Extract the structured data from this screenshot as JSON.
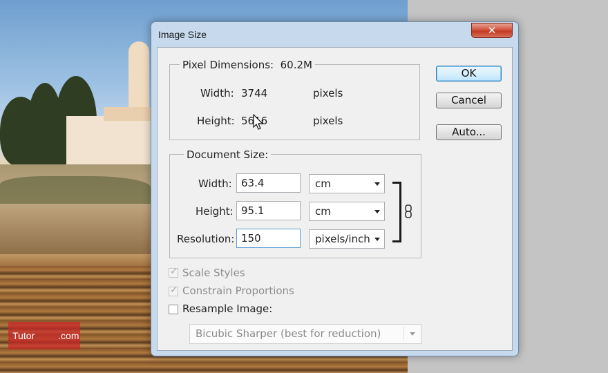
{
  "dialog": {
    "title": "Image Size",
    "close_glyph": "✕"
  },
  "pixel_dimensions": {
    "legend": "Pixel Dimensions:",
    "size_value": "60.2M",
    "width_label": "Width:",
    "width_value": "3744",
    "width_unit": "pixels",
    "height_label": "Height:",
    "height_value": "5616",
    "height_unit": "pixels"
  },
  "document_size": {
    "legend": "Document Size:",
    "width_label": "Width:",
    "width_value": "63.4",
    "width_unit": "cm",
    "height_label": "Height:",
    "height_value": "95.1",
    "height_unit": "cm",
    "resolution_label": "Resolution:",
    "resolution_value": "150",
    "resolution_unit": "pixels/inch",
    "link_icon": "chain-link-icon"
  },
  "buttons": {
    "ok": "OK",
    "cancel": "Cancel",
    "auto": "Auto..."
  },
  "options": {
    "scale_styles": {
      "label": "Scale Styles",
      "checked": true,
      "enabled": false
    },
    "constrain_proportions": {
      "label": "Constrain Proportions",
      "checked": true,
      "enabled": false
    },
    "resample_image": {
      "label": "Resample Image:",
      "checked": false,
      "enabled": true
    },
    "resample_method": "Bicubic Sharper (best for reduction)"
  },
  "watermark": {
    "text_left": "Tutor",
    "text_right": ".com"
  }
}
